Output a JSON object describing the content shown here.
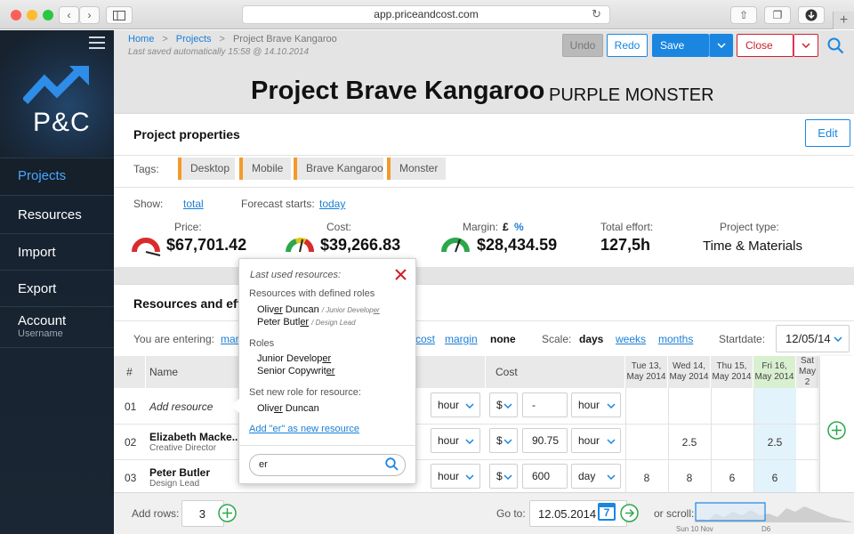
{
  "browser": {
    "url": "app.priceandcost.com"
  },
  "sidebar": {
    "logo_text": "P&C",
    "items": [
      {
        "label": "Projects"
      },
      {
        "label": "Resources"
      },
      {
        "label": "Import"
      },
      {
        "label": "Export"
      },
      {
        "label": "Account",
        "sub": "Username"
      }
    ]
  },
  "breadcrumb": {
    "home": "Home",
    "sep": ">",
    "projects": "Projects",
    "current": "Project Brave Kangaroo"
  },
  "save_status": "Last saved automatically 15:58 @ 14.10.2014",
  "toolbar": {
    "undo": "Undo",
    "redo": "Redo",
    "save": "Save",
    "close": "Close"
  },
  "project": {
    "title": "Project Brave Kangaroo",
    "subtitle": "PURPLE MONSTER"
  },
  "properties": {
    "heading": "Project properties",
    "edit": "Edit",
    "tags_label": "Tags:",
    "tags": [
      "Desktop",
      "Mobile",
      "Brave Kangaroo",
      "Monster"
    ],
    "show_label": "Show:",
    "show_value": "total",
    "forecast_label": "Forecast starts:",
    "forecast_value": "today",
    "price_label": "Price:",
    "price": "$67,701.42",
    "cost_label": "Cost:",
    "cost": "$39,266.83",
    "margin_label": "Margin:",
    "margin_pound": "£",
    "margin_pct": "%",
    "margin": "$28,434.59",
    "effort_label": "Total effort:",
    "effort": "127,5h",
    "type_label": "Project type:",
    "type": "Time & Materials"
  },
  "resources": {
    "heading": "Resources and effo",
    "entering_label": "You are entering:",
    "entering_partial": "mar",
    "entering_opts": [
      "cost",
      "margin",
      "none"
    ],
    "scale_label": "Scale:",
    "scale_opts": [
      "days",
      "weeks",
      "months"
    ],
    "startdate_label": "Startdate:",
    "startdate": "12/05/14",
    "col_hash": "#",
    "col_name": "Name",
    "col_cost": "Cost",
    "days": [
      {
        "d": "Tue 13,",
        "m": "May 2014"
      },
      {
        "d": "Wed 14,",
        "m": "May 2014"
      },
      {
        "d": "Thu 15,",
        "m": "May 2014"
      },
      {
        "d": "Fri 16,",
        "m": "May 2014"
      },
      {
        "d": "Sat",
        "m": "May 2"
      }
    ],
    "rows": [
      {
        "no": "01",
        "name": "Add resource",
        "role": "",
        "price_unit": "hour",
        "cur": "$",
        "cost": "-",
        "cost_unit": "hour",
        "vals": [
          "",
          "",
          "",
          ""
        ]
      },
      {
        "no": "02",
        "name": "Elizabeth Macke...",
        "role": "Creative Director",
        "price_unit": "hour",
        "cur": "$",
        "cost": "90.75",
        "cost_unit": "hour",
        "vals": [
          "",
          "2.5",
          "",
          "2.5"
        ]
      },
      {
        "no": "03",
        "name": "Peter Butler",
        "role": "Design Lead",
        "price_unit": "hour",
        "cur": "$",
        "cost": "600",
        "cost_unit": "day",
        "vals": [
          "8",
          "8",
          "6",
          "6"
        ]
      }
    ]
  },
  "popup": {
    "title": "Last used resources:",
    "sec1": "Resources with defined roles",
    "r1": {
      "a": "Oliv",
      "b": "er",
      "c": " Duncan",
      "role_a": "/ Junior Develop",
      "role_b": "er"
    },
    "r2": {
      "a": "Peter Butl",
      "b": "er",
      "role": "/ Design Lead"
    },
    "sec2": "Roles",
    "role1": {
      "a": "Junior Develop",
      "b": "er"
    },
    "role2": {
      "a": "Senior Copywrit",
      "b": "er"
    },
    "sec3": "Set new role for resource:",
    "r3": {
      "a": "Oliv",
      "b": "er",
      "c": " Duncan"
    },
    "add_link": "Add \"er\" as new resource",
    "search_value": "er"
  },
  "footer": {
    "add_rows_label": "Add rows:",
    "add_rows_value": "3",
    "goto_label": "Go to:",
    "goto_value": "12.05.2014",
    "cal_day": "7",
    "scroll_label": "or scroll:",
    "scroll_ticks": [
      "Sun 10 Nov",
      "D6"
    ]
  },
  "colors": {
    "accent": "#1a7fd6",
    "save": "#1a86e0",
    "close": "#d0202a",
    "tag": "#f39a2b",
    "green": "#2aa84a"
  }
}
